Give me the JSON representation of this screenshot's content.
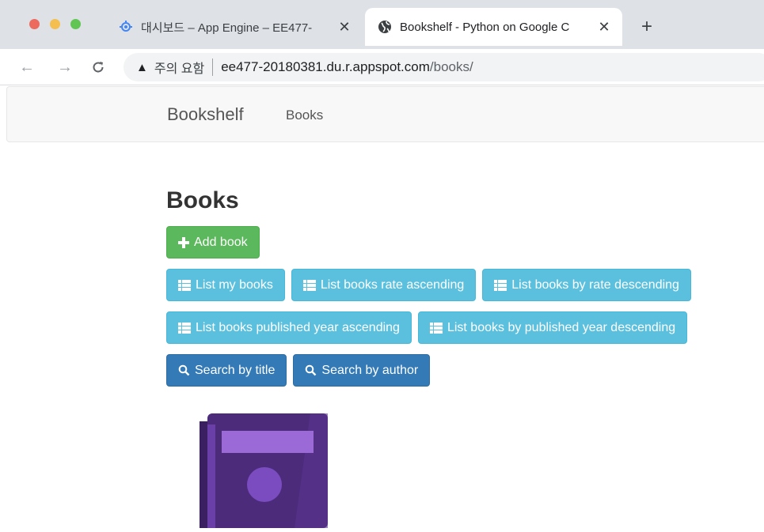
{
  "browser": {
    "tabs": [
      {
        "title": "대시보드 – App Engine – EE477-",
        "icon": "app-engine-icon",
        "active": false
      },
      {
        "title": "Bookshelf - Python on Google C",
        "icon": "globe-icon",
        "active": true
      }
    ],
    "address": {
      "security_label": "주의 요함",
      "host": "ee477-20180381.du.r.appspot.com",
      "path": "/books/"
    }
  },
  "navbar": {
    "brand": "Bookshelf",
    "links": [
      "Books"
    ]
  },
  "page": {
    "title": "Books",
    "buttons": {
      "add_book": "Add book",
      "list_my_books": "List my books",
      "list_rate_asc": "List books rate ascending",
      "list_rate_desc": "List books by rate descending",
      "list_year_asc": "List books published year ascending",
      "list_year_desc": "List books by published year descending",
      "search_title": "Search by title",
      "search_author": "Search by author"
    }
  },
  "colors": {
    "success": "#5cb85c",
    "info": "#5bc0de",
    "primary": "#337ab7",
    "book_purple": "#4b2b7a"
  }
}
